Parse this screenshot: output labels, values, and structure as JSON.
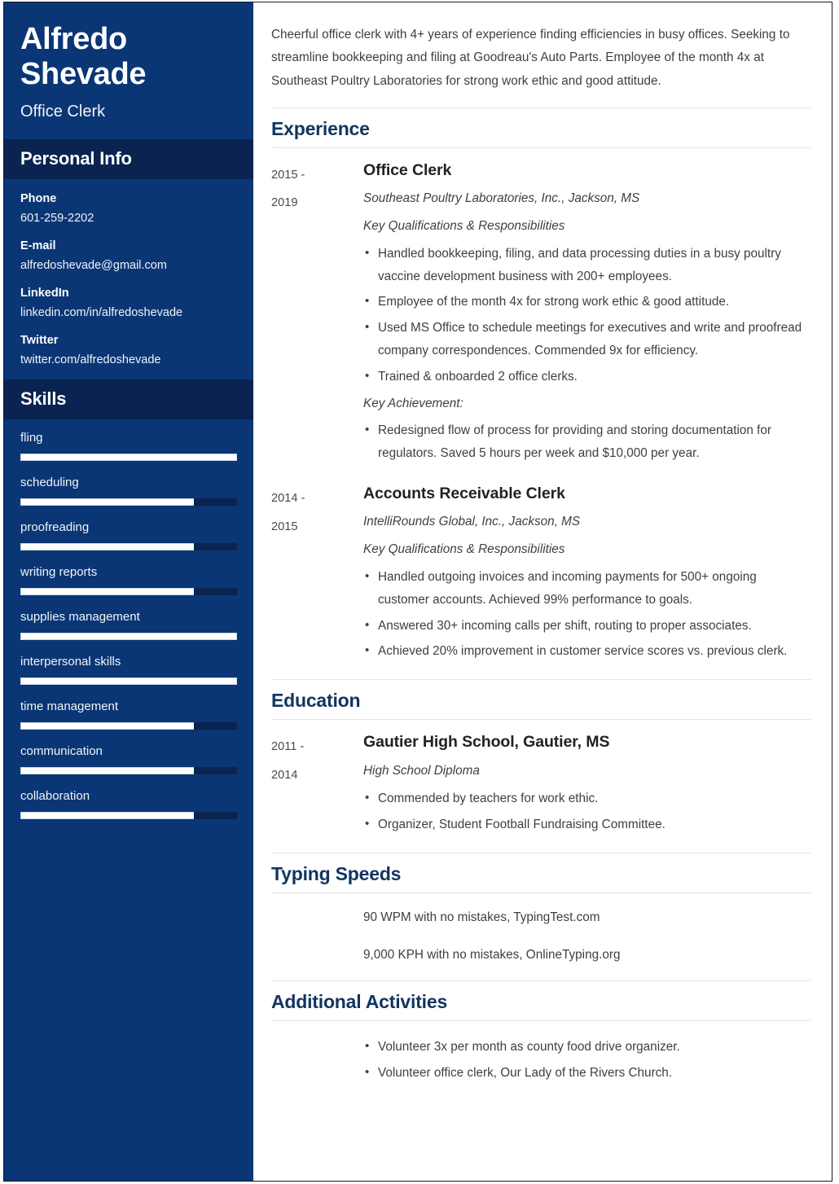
{
  "colors": {
    "sidebar_bg": "#0a3675",
    "sidebar_head_bg": "#0a2350",
    "accent_heading": "#123560",
    "body_text": "#3f3f3f",
    "skill_fill": "#ffffff",
    "skill_track": "#0a2350"
  },
  "sidebar": {
    "name": "Alfredo Shevade",
    "job_title": "Office Clerk",
    "personal_info_heading": "Personal Info",
    "contacts": [
      {
        "label": "Phone",
        "value": "601-259-2202"
      },
      {
        "label": "E-mail",
        "value": "alfredoshevade@gmail.com"
      },
      {
        "label": "LinkedIn",
        "value": "linkedin.com/in/alfredoshevade"
      },
      {
        "label": "Twitter",
        "value": "twitter.com/alfredoshevade"
      }
    ],
    "skills_heading": "Skills",
    "skills": [
      {
        "name": "fling",
        "level": 100
      },
      {
        "name": "scheduling",
        "level": 80
      },
      {
        "name": "proofreading",
        "level": 80
      },
      {
        "name": "writing reports",
        "level": 80
      },
      {
        "name": "supplies management",
        "level": 100
      },
      {
        "name": "interpersonal skills",
        "level": 100
      },
      {
        "name": "time management",
        "level": 80
      },
      {
        "name": "communication",
        "level": 80
      },
      {
        "name": "collaboration",
        "level": 80
      }
    ]
  },
  "main": {
    "summary": "Cheerful office clerk with 4+ years of experience finding efficiencies in busy offices. Seeking to streamline bookkeeping and filing at Goodreau's Auto Parts. Employee of the month 4x at Southeast Poultry Laboratories for strong work ethic and good attitude.",
    "experience_heading": "Experience",
    "experience": [
      {
        "date_from": "2015 -",
        "date_to": "2019",
        "role": "Office Clerk",
        "org": "Southeast Poultry Laboratories, Inc., Jackson, MS",
        "qualifications_label": "Key Qualifications & Responsibilities",
        "bullets": [
          "Handled bookkeeping, filing, and data processing duties in a busy poultry vaccine development business with 200+ employees.",
          "Employee of the month 4x for strong work ethic & good attitude.",
          "Used MS Office to schedule meetings for executives and write and proofread company correspondences. Commended 9x for efficiency.",
          "Trained & onboarded 2 office clerks."
        ],
        "achievement_label": "Key Achievement:",
        "achievement_bullets": [
          "Redesigned flow of process for providing and storing documentation for regulators. Saved 5 hours per week and $10,000 per year."
        ]
      },
      {
        "date_from": "2014 -",
        "date_to": "2015",
        "role": "Accounts Receivable Clerk",
        "org": "IntelliRounds Global, Inc., Jackson, MS",
        "qualifications_label": "Key Qualifications & Responsibilities",
        "bullets": [
          "Handled outgoing invoices and incoming payments for 500+ ongoing customer accounts. Achieved 99% performance to goals.",
          "Answered 30+ incoming calls per shift, routing to proper associates.",
          "Achieved 20% improvement in customer service scores vs. previous clerk."
        ],
        "achievement_label": "",
        "achievement_bullets": []
      }
    ],
    "education_heading": "Education",
    "education": [
      {
        "date_from": "2011 -",
        "date_to": "2014",
        "school": "Gautier High School, Gautier, MS",
        "degree": "High School Diploma",
        "bullets": [
          "Commended by teachers for work ethic.",
          "Organizer, Student Football Fundraising Committee."
        ]
      }
    ],
    "typing_heading": "Typing Speeds",
    "typing_lines": [
      "90 WPM with no mistakes, TypingTest.com",
      "9,000 KPH with no mistakes, OnlineTyping.org"
    ],
    "activities_heading": "Additional Activities",
    "activities": [
      "Volunteer 3x per month as county food drive organizer.",
      "Volunteer office clerk, Our Lady of the Rivers Church."
    ]
  }
}
